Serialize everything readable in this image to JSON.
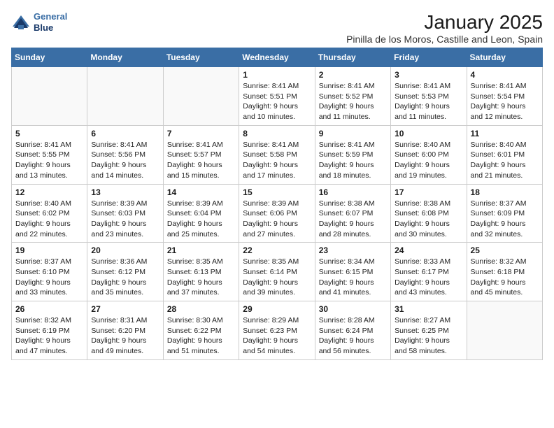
{
  "logo": {
    "line1": "General",
    "line2": "Blue"
  },
  "title": "January 2025",
  "subtitle": "Pinilla de los Moros, Castille and Leon, Spain",
  "days": [
    "Sunday",
    "Monday",
    "Tuesday",
    "Wednesday",
    "Thursday",
    "Friday",
    "Saturday"
  ],
  "weeks": [
    [
      {
        "day": "",
        "info": ""
      },
      {
        "day": "",
        "info": ""
      },
      {
        "day": "",
        "info": ""
      },
      {
        "day": "1",
        "info": "Sunrise: 8:41 AM\nSunset: 5:51 PM\nDaylight: 9 hours\nand 10 minutes."
      },
      {
        "day": "2",
        "info": "Sunrise: 8:41 AM\nSunset: 5:52 PM\nDaylight: 9 hours\nand 11 minutes."
      },
      {
        "day": "3",
        "info": "Sunrise: 8:41 AM\nSunset: 5:53 PM\nDaylight: 9 hours\nand 11 minutes."
      },
      {
        "day": "4",
        "info": "Sunrise: 8:41 AM\nSunset: 5:54 PM\nDaylight: 9 hours\nand 12 minutes."
      }
    ],
    [
      {
        "day": "5",
        "info": "Sunrise: 8:41 AM\nSunset: 5:55 PM\nDaylight: 9 hours\nand 13 minutes."
      },
      {
        "day": "6",
        "info": "Sunrise: 8:41 AM\nSunset: 5:56 PM\nDaylight: 9 hours\nand 14 minutes."
      },
      {
        "day": "7",
        "info": "Sunrise: 8:41 AM\nSunset: 5:57 PM\nDaylight: 9 hours\nand 15 minutes."
      },
      {
        "day": "8",
        "info": "Sunrise: 8:41 AM\nSunset: 5:58 PM\nDaylight: 9 hours\nand 17 minutes."
      },
      {
        "day": "9",
        "info": "Sunrise: 8:41 AM\nSunset: 5:59 PM\nDaylight: 9 hours\nand 18 minutes."
      },
      {
        "day": "10",
        "info": "Sunrise: 8:40 AM\nSunset: 6:00 PM\nDaylight: 9 hours\nand 19 minutes."
      },
      {
        "day": "11",
        "info": "Sunrise: 8:40 AM\nSunset: 6:01 PM\nDaylight: 9 hours\nand 21 minutes."
      }
    ],
    [
      {
        "day": "12",
        "info": "Sunrise: 8:40 AM\nSunset: 6:02 PM\nDaylight: 9 hours\nand 22 minutes."
      },
      {
        "day": "13",
        "info": "Sunrise: 8:39 AM\nSunset: 6:03 PM\nDaylight: 9 hours\nand 23 minutes."
      },
      {
        "day": "14",
        "info": "Sunrise: 8:39 AM\nSunset: 6:04 PM\nDaylight: 9 hours\nand 25 minutes."
      },
      {
        "day": "15",
        "info": "Sunrise: 8:39 AM\nSunset: 6:06 PM\nDaylight: 9 hours\nand 27 minutes."
      },
      {
        "day": "16",
        "info": "Sunrise: 8:38 AM\nSunset: 6:07 PM\nDaylight: 9 hours\nand 28 minutes."
      },
      {
        "day": "17",
        "info": "Sunrise: 8:38 AM\nSunset: 6:08 PM\nDaylight: 9 hours\nand 30 minutes."
      },
      {
        "day": "18",
        "info": "Sunrise: 8:37 AM\nSunset: 6:09 PM\nDaylight: 9 hours\nand 32 minutes."
      }
    ],
    [
      {
        "day": "19",
        "info": "Sunrise: 8:37 AM\nSunset: 6:10 PM\nDaylight: 9 hours\nand 33 minutes."
      },
      {
        "day": "20",
        "info": "Sunrise: 8:36 AM\nSunset: 6:12 PM\nDaylight: 9 hours\nand 35 minutes."
      },
      {
        "day": "21",
        "info": "Sunrise: 8:35 AM\nSunset: 6:13 PM\nDaylight: 9 hours\nand 37 minutes."
      },
      {
        "day": "22",
        "info": "Sunrise: 8:35 AM\nSunset: 6:14 PM\nDaylight: 9 hours\nand 39 minutes."
      },
      {
        "day": "23",
        "info": "Sunrise: 8:34 AM\nSunset: 6:15 PM\nDaylight: 9 hours\nand 41 minutes."
      },
      {
        "day": "24",
        "info": "Sunrise: 8:33 AM\nSunset: 6:17 PM\nDaylight: 9 hours\nand 43 minutes."
      },
      {
        "day": "25",
        "info": "Sunrise: 8:32 AM\nSunset: 6:18 PM\nDaylight: 9 hours\nand 45 minutes."
      }
    ],
    [
      {
        "day": "26",
        "info": "Sunrise: 8:32 AM\nSunset: 6:19 PM\nDaylight: 9 hours\nand 47 minutes."
      },
      {
        "day": "27",
        "info": "Sunrise: 8:31 AM\nSunset: 6:20 PM\nDaylight: 9 hours\nand 49 minutes."
      },
      {
        "day": "28",
        "info": "Sunrise: 8:30 AM\nSunset: 6:22 PM\nDaylight: 9 hours\nand 51 minutes."
      },
      {
        "day": "29",
        "info": "Sunrise: 8:29 AM\nSunset: 6:23 PM\nDaylight: 9 hours\nand 54 minutes."
      },
      {
        "day": "30",
        "info": "Sunrise: 8:28 AM\nSunset: 6:24 PM\nDaylight: 9 hours\nand 56 minutes."
      },
      {
        "day": "31",
        "info": "Sunrise: 8:27 AM\nSunset: 6:25 PM\nDaylight: 9 hours\nand 58 minutes."
      },
      {
        "day": "",
        "info": ""
      }
    ]
  ]
}
